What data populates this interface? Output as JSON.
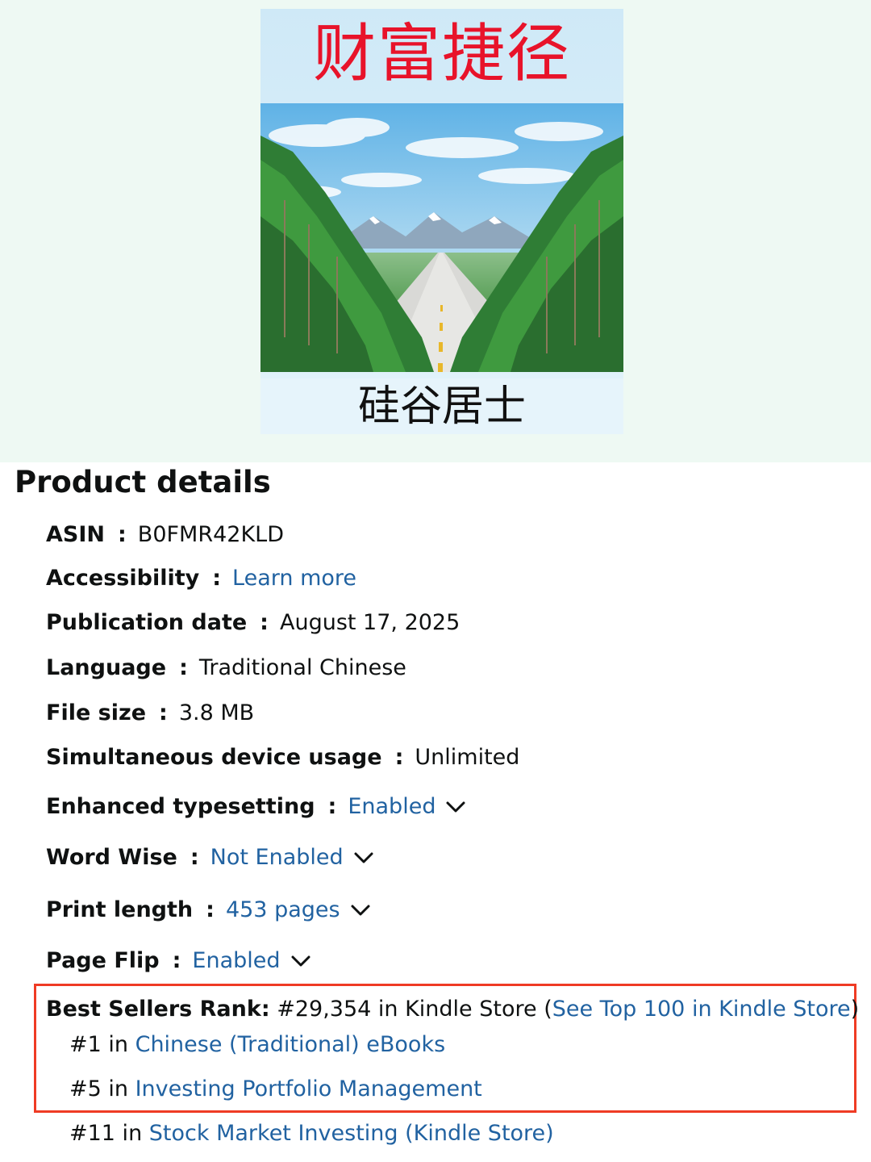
{
  "cover": {
    "title": "财富捷径",
    "author": "硅谷居士",
    "title_color": "#e8132a"
  },
  "product_details": {
    "heading": "Product details",
    "separator": ":",
    "rows": [
      {
        "label": "ASIN",
        "value": "B0FMR42KLD"
      },
      {
        "label": "Accessibility",
        "value": "Learn more",
        "link": true
      },
      {
        "label": "Publication date",
        "value": "August 17, 2025"
      },
      {
        "label": "Language",
        "value": "Traditional Chinese"
      },
      {
        "label": "File size",
        "value": "3.8 MB"
      },
      {
        "label": "Simultaneous device usage",
        "value": "Unlimited"
      },
      {
        "label": "Enhanced typesetting",
        "value": "Enabled",
        "link": true,
        "chevron": "chevron-down-icon"
      },
      {
        "label": "Word Wise",
        "value": "Not Enabled",
        "link": true,
        "chevron": "chevron-down-icon"
      },
      {
        "label": "Print length",
        "value": "453 pages",
        "link": true,
        "chevron": "chevron-down-icon"
      },
      {
        "label": "Page Flip",
        "value": "Enabled",
        "link": true,
        "chevron": "chevron-down-icon"
      }
    ],
    "best_sellers": {
      "label": "Best Sellers Rank:",
      "overall": "#29,354 in Kindle Store (",
      "overall_link": "See Top 100 in Kindle Store",
      "overall_close": ")",
      "sub_ranks": [
        {
          "rank": "#1 in ",
          "category": "Chinese (Traditional) eBooks"
        },
        {
          "rank": "#5 in ",
          "category": "Investing Portfolio Management"
        },
        {
          "rank": "#11 in ",
          "category": "Stock Market Investing (Kindle Store)"
        }
      ]
    }
  },
  "colors": {
    "link": "#2162a1",
    "highlight_box": "#ef3b24",
    "top_background": "#eef9f3"
  }
}
